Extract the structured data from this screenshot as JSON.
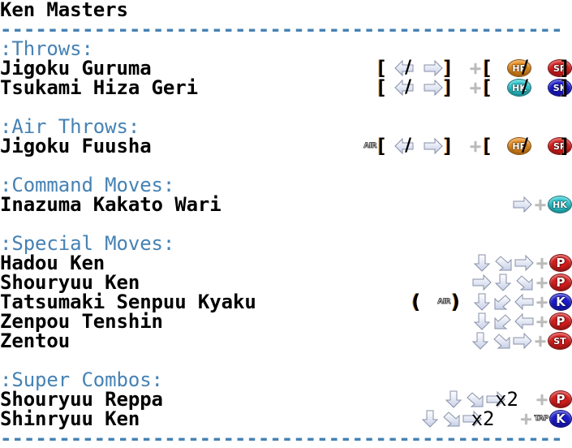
{
  "character": {
    "name": "Ken Masters"
  },
  "separator": "------------------------------------------------",
  "sections": [
    {
      "header": ":Throws:",
      "moves": [
        {
          "name": "Jigoku Guruma",
          "input": "[ back / forward ] + [ HP / SP ]"
        },
        {
          "name": "Tsukami Hiza Geri",
          "input": "[ back / forward ] + [ HK / SK ]"
        }
      ]
    },
    {
      "header": ":Air Throws:",
      "moves": [
        {
          "name": "Jigoku Fuusha",
          "input": "AIR [ back / forward ] + [ HP / SP ]"
        }
      ]
    },
    {
      "header": ":Command Moves:",
      "moves": [
        {
          "name": "Inazuma Kakato Wari",
          "input": "forward + HK"
        }
      ]
    },
    {
      "header": ":Special Moves:",
      "moves": [
        {
          "name": "Hadou Ken",
          "input": "down, down-forward, forward + P"
        },
        {
          "name": "Shouryuu Ken",
          "input": "forward, down, down-forward + P"
        },
        {
          "name": "Tatsumaki Senpuu Kyaku",
          "input": "( AIR ) down, down-back, back + K"
        },
        {
          "name": "Zenpou Tenshin",
          "input": "down, down-back, back + P"
        },
        {
          "name": "Zentou",
          "input": "down, down-forward, forward + ST"
        }
      ]
    },
    {
      "header": ":Super Combos:",
      "moves": [
        {
          "name": "Shouryuu Reppa",
          "input": "down, down-forward, forward x2 + P"
        },
        {
          "name": "Shinryuu Ken",
          "input": "down, down-forward, forward x2 + TAP K"
        }
      ]
    }
  ],
  "icons": {
    "bracket_open": "[",
    "bracket_close": "]",
    "paren_open": "(",
    "paren_close": ")",
    "slash": "/",
    "plus": "+",
    "air": "AIR",
    "tap": "TAP",
    "times_two": "x2"
  },
  "buttons": {
    "HP": {
      "label": "HP",
      "color": "#e88a1a"
    },
    "SP": {
      "label": "SP",
      "color": "#d81c1c"
    },
    "HK": {
      "label": "HK",
      "color": "#2ac8d0"
    },
    "SK": {
      "label": "SK",
      "color": "#1a1ad0"
    },
    "P": {
      "label": "P",
      "color": "#d81c1c"
    },
    "K": {
      "label": "K",
      "color": "#1a1ad0"
    },
    "ST": {
      "label": "ST",
      "color": "#d81c1c"
    }
  }
}
